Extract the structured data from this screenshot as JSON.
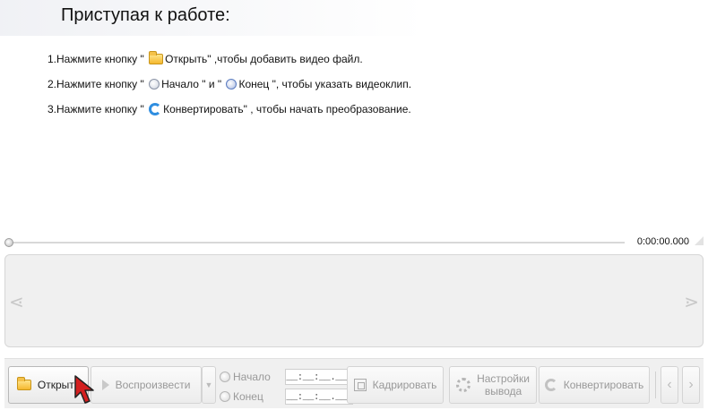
{
  "heading": "Приступая к работе:",
  "steps": {
    "s1": {
      "num": "1.",
      "pre": "Нажмите кнопку \" ",
      "btn": "Открыть",
      "post": "\" ,чтобы добавить видео файл."
    },
    "s2": {
      "num": "2.",
      "pre": "Нажмите кнопку \" ",
      "btn1": "Начало",
      "mid": " \" и \" ",
      "btn2": "Конец",
      "post": " \", чтобы указать видеоклип."
    },
    "s3": {
      "num": "3.",
      "pre": "Нажмите кнопку \" ",
      "btn": "Конвертировать",
      "post": "\" , чтобы начать преобразование."
    }
  },
  "player": {
    "time": "0:00:00.000"
  },
  "toolbar": {
    "open": "Открыть",
    "play": "Воспроизвести",
    "start_label": "Начало",
    "end_label": "Конец",
    "start_value": "__:__:__.___",
    "end_value": "__:__:__.___",
    "crop": "Кадрировать",
    "settings_line1": "Настройки",
    "settings_line2": "вывода",
    "convert": "Конвертировать"
  },
  "icons": {
    "open": "folder-icon",
    "start": "clock-icon",
    "end": "clock-icon",
    "convert": "convert-icon",
    "play": "play-icon",
    "crop": "crop-icon",
    "settings": "gear-icon"
  },
  "colors": {
    "accent": "#2f8ee0",
    "cursor": "#d42020"
  }
}
